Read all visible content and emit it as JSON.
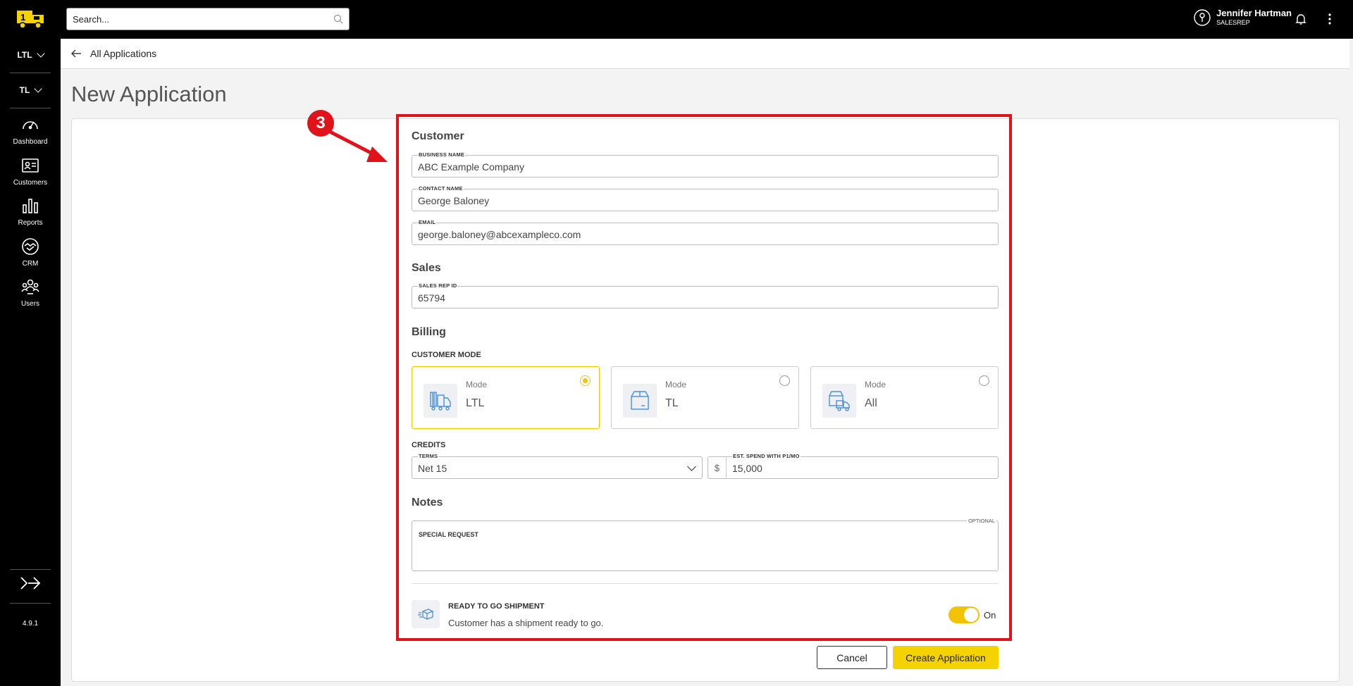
{
  "sidebar": {
    "mode_selectors": [
      {
        "label": "LTL"
      },
      {
        "label": "TL"
      }
    ],
    "nav": [
      {
        "label": "Dashboard",
        "icon": "gauge-icon"
      },
      {
        "label": "Customers",
        "icon": "id-card-icon"
      },
      {
        "label": "Reports",
        "icon": "bar-chart-icon"
      },
      {
        "label": "CRM",
        "icon": "handshake-icon"
      },
      {
        "label": "Users",
        "icon": "users-icon"
      }
    ],
    "version": "4.9.1"
  },
  "topbar": {
    "search_placeholder": "Search...",
    "user_name": "Jennifer Hartman",
    "user_role": "SALESREP"
  },
  "breadcrumb": {
    "back_label": "All Applications"
  },
  "page_title": "New Application",
  "annotation": {
    "step_number": "3",
    "color": "#e0131b"
  },
  "form": {
    "customer": {
      "heading": "Customer",
      "business_name_label": "BUSINESS NAME",
      "business_name": "ABC Example Company",
      "contact_name_label": "CONTACT NAME",
      "contact_name": "George Baloney",
      "email_label": "EMAIL",
      "email": "george.baloney@abcexampleco.com"
    },
    "sales": {
      "heading": "Sales",
      "sales_rep_id_label": "SALES REP ID",
      "sales_rep_id": "65794"
    },
    "billing": {
      "heading": "Billing",
      "customer_mode_label": "CUSTOMER MODE",
      "modes": [
        {
          "label": "Mode",
          "value": "LTL",
          "selected": true
        },
        {
          "label": "Mode",
          "value": "TL",
          "selected": false
        },
        {
          "label": "Mode",
          "value": "All",
          "selected": false
        }
      ],
      "credits_label": "CREDITS",
      "terms_label": "TERMS",
      "terms_value": "Net 15",
      "est_spend_label": "EST. SPEND WITH P1/MO",
      "currency_symbol": "$",
      "est_spend_value": "15,000"
    },
    "notes": {
      "heading": "Notes",
      "special_request_label": "SPECIAL REQUEST",
      "optional_label": "OPTIONAL"
    },
    "ready_to_go": {
      "title": "READY TO GO SHIPMENT",
      "description": "Customer has a shipment ready to go.",
      "toggle_state": "On"
    }
  },
  "actions": {
    "cancel_label": "Cancel",
    "create_label": "Create Application"
  },
  "colors": {
    "accent": "#f2c300",
    "sidebar_bg": "#000000",
    "highlight_box": "#e0131b"
  }
}
